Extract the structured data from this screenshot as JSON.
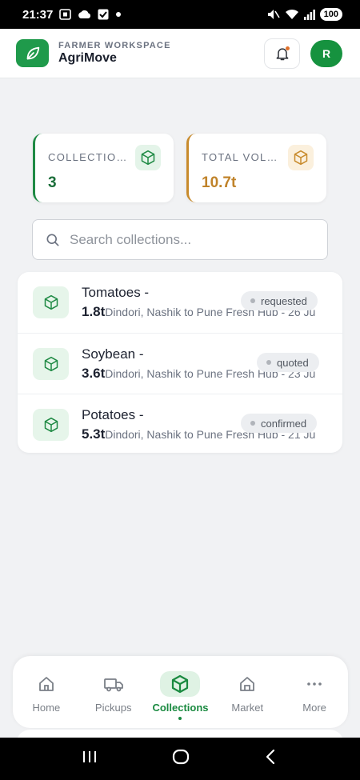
{
  "status_bar": {
    "time": "21:37",
    "battery": "100"
  },
  "header": {
    "kicker": "FARMER WORKSPACE",
    "app_name": "AgriMove",
    "avatar_initial": "R"
  },
  "stats": [
    {
      "label": "COLLECTIONS",
      "value": "3",
      "icon": "box-icon",
      "accent": "#1f8a44"
    },
    {
      "label": "TOTAL VOLUME",
      "value": "10.7t",
      "icon": "box-icon",
      "accent": "#c88b2c"
    }
  ],
  "search": {
    "placeholder": "Search collections..."
  },
  "collections": [
    {
      "title": "Tomatoes -",
      "qty": "1.8t",
      "route": "Dindori, Nashik to Pune Fresh Hub - 26 Ju",
      "status": "requested"
    },
    {
      "title": "Soybean -",
      "qty": "3.6t",
      "route": "Dindori, Nashik to Pune Fresh Hub - 23 Ju",
      "status": "quoted"
    },
    {
      "title": "Potatoes -",
      "qty": "5.3t",
      "route": "Dindori, Nashik to Pune Fresh Hub - 21 Ju",
      "status": "confirmed"
    }
  ],
  "bottom_nav": [
    {
      "label": "Home",
      "icon": "home-icon",
      "active": false
    },
    {
      "label": "Pickups",
      "icon": "truck-icon",
      "active": false
    },
    {
      "label": "Collections",
      "icon": "box-icon",
      "active": true
    },
    {
      "label": "Market",
      "icon": "store-icon",
      "active": false
    },
    {
      "label": "More",
      "icon": "more-icon",
      "active": false
    }
  ],
  "colors": {
    "brand_green": "#1f9a4b",
    "amber": "#c88b2c",
    "background": "#f1f2f4"
  }
}
